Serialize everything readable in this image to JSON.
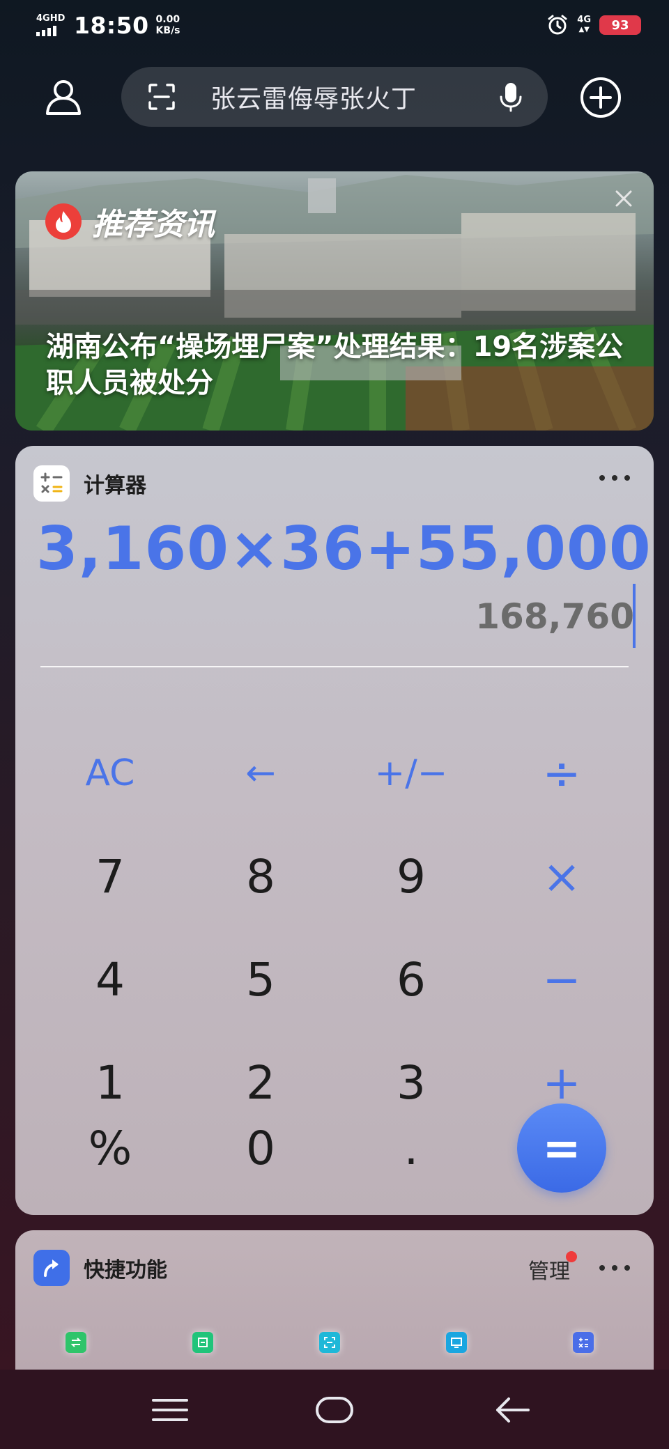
{
  "status_bar": {
    "network_left": "4GHD",
    "time": "18:50",
    "speed_value": "0.00",
    "speed_unit": "KB/s",
    "network_right": "4G",
    "battery": "93"
  },
  "search": {
    "text": "张云雷侮辱张火丁"
  },
  "news": {
    "section_label": "推荐资讯",
    "headline": "湖南公布“操场埋尸案”处理结果：19名涉案公职人员被处分"
  },
  "calculator": {
    "title": "计算器",
    "expression": "3,160×36+55,000",
    "result": "168,760",
    "keys": {
      "ac": "AC",
      "backspace": "←",
      "sign": "+/−",
      "divide": "÷",
      "seven": "7",
      "eight": "8",
      "nine": "9",
      "multiply": "×",
      "four": "4",
      "five": "5",
      "six": "6",
      "minus": "−",
      "one": "1",
      "two": "2",
      "three": "3",
      "plus": "+",
      "percent": "%",
      "zero": "0",
      "dot": ".",
      "equals": "="
    }
  },
  "shortcuts": {
    "title": "快捷功能",
    "manage_label": "管理",
    "items": [
      {
        "icon": "transfer-icon",
        "color": "#2fc46a"
      },
      {
        "icon": "refresh-icon",
        "color": "#20c47a"
      },
      {
        "icon": "scan-icon",
        "color": "#1fb8d8"
      },
      {
        "icon": "screen-icon",
        "color": "#1aa6e0"
      },
      {
        "icon": "calculator-icon",
        "color": "#4a6ee8"
      }
    ]
  },
  "colors": {
    "accent_blue": "#4a74e8",
    "badge_red": "#ef3b3b",
    "battery_red": "#e0394a"
  }
}
